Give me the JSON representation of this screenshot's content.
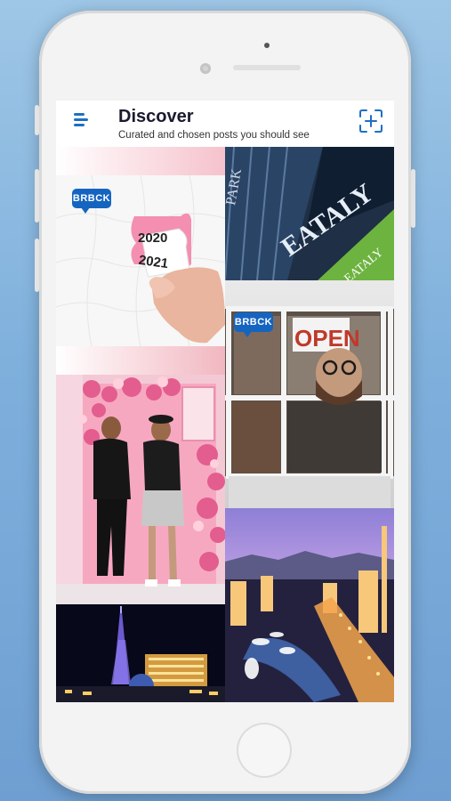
{
  "header": {
    "title": "Discover",
    "subtitle": "Curated and chosen posts you should see"
  },
  "icons": {
    "menu": "menu-icon",
    "scan_add": "scan-add-icon"
  },
  "posts": [
    {
      "id": "puzzle",
      "badge": "BRBCK",
      "top_text": "2020",
      "bottom_text": "2021"
    },
    {
      "id": "eataly",
      "sign_text": "EATALY",
      "side_text": "PARK",
      "green_sign": "EATALY"
    },
    {
      "id": "open-sign",
      "badge": "BRBCK",
      "sign_text": "OPEN"
    },
    {
      "id": "flower-wall",
      "sign_text": ""
    },
    {
      "id": "vegas-strip"
    },
    {
      "id": "eiffel-night"
    }
  ],
  "colors": {
    "accent": "#1e6fc2",
    "badge": "#1565c0",
    "title": "#1a1a2e"
  }
}
